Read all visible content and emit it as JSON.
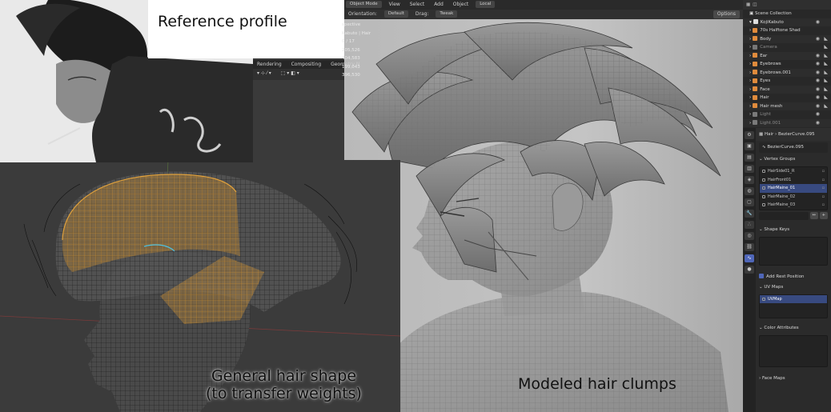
{
  "captions": {
    "reference": "Reference profile",
    "general_hair_line1": "General hair shape",
    "general_hair_line2": "(to transfer weights)",
    "modeled": "Modeled hair clumps"
  },
  "header": {
    "mode": "Object Mode",
    "menus": [
      "View",
      "Select",
      "Add",
      "Object"
    ],
    "transform_space": "Local",
    "orientation_label": "Orientation:",
    "orientation_value": "Default",
    "drag_label": "Drag:",
    "drag_value": "Tweak",
    "options": "Options"
  },
  "workspace_tabs": [
    "Rendering",
    "Compositing",
    "Geometry N"
  ],
  "viewport_stats": {
    "view": "spective",
    "object": "Kabuto | Hair",
    "values": [
      "0 / 17",
      "205,526",
      "404,583",
      "199,043",
      "396,530"
    ]
  },
  "outliner": {
    "title": "Scene Collection",
    "items": [
      {
        "label": "KojiKabuto",
        "dim": false
      },
      {
        "label": "70s Halftone Shad",
        "dim": false
      },
      {
        "label": "Body",
        "dim": false
      },
      {
        "label": "Camera",
        "dim": true
      },
      {
        "label": "Ear",
        "dim": false
      },
      {
        "label": "Eyebrows",
        "dim": false
      },
      {
        "label": "Eyebrows.001",
        "dim": false
      },
      {
        "label": "Eyes",
        "dim": false
      },
      {
        "label": "Face",
        "dim": false
      },
      {
        "label": "Hair",
        "dim": false
      },
      {
        "label": "Hair mesh",
        "dim": false
      },
      {
        "label": "Light",
        "dim": true
      },
      {
        "label": "Light.001",
        "dim": true
      }
    ]
  },
  "properties": {
    "breadcrumb_object": "Hair",
    "breadcrumb_data": "BezierCurve.095",
    "data_name": "BezierCurve.095",
    "vertex_groups_title": "Vertex Groups",
    "vertex_groups": [
      "HairSide01_R",
      "HairFront01",
      "HairMaine_01",
      "HairMaine_02",
      "HairMaine_03"
    ],
    "vertex_groups_selected": 2,
    "shape_keys_title": "Shape Keys",
    "add_rest_position": "Add Rest Position",
    "uv_maps_title": "UV Maps",
    "uv_map_item": "UVMap",
    "color_attributes_title": "Color Attributes",
    "face_maps_title": "Face Maps"
  },
  "colors": {
    "wire_orange": "#e0a13c",
    "selection_blue": "#4f66b8",
    "viewport_dark": "#3b3b3b",
    "clay_grey": "#bdbdbd"
  }
}
